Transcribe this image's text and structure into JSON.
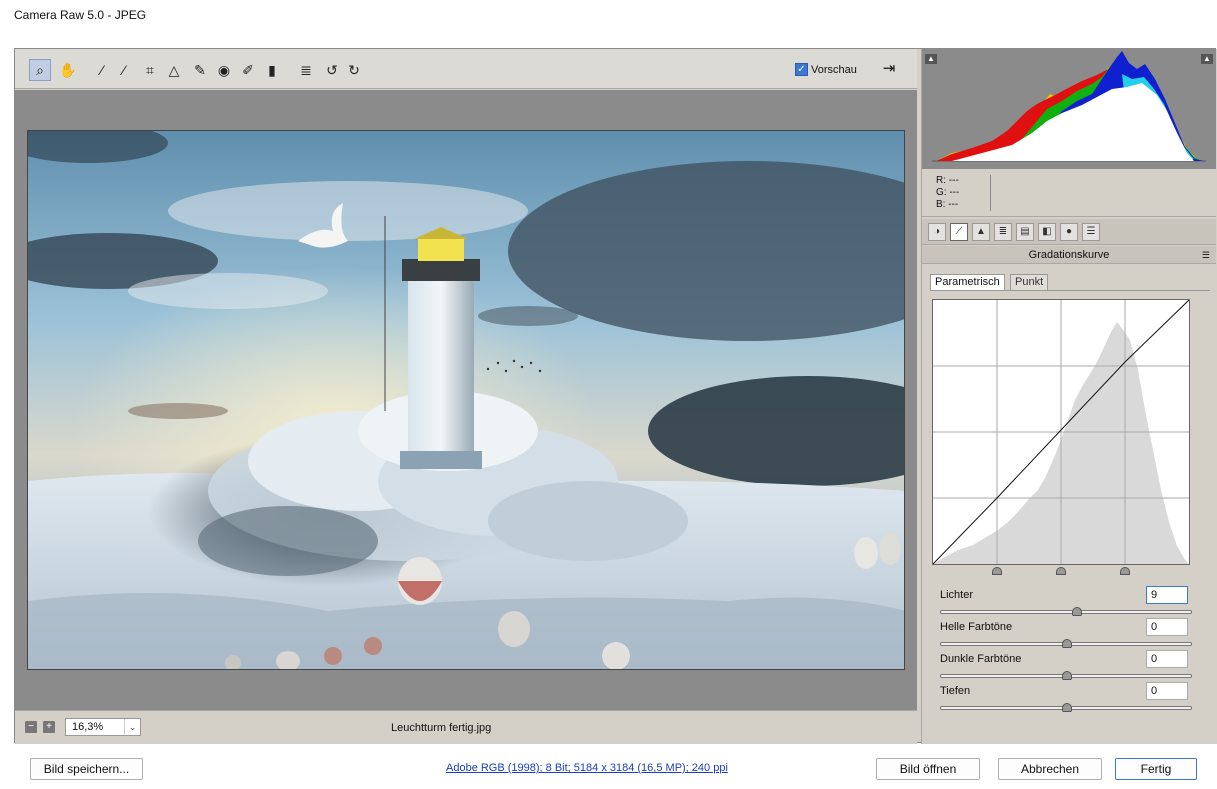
{
  "window": {
    "title": "Camera Raw 5.0 - JPEG"
  },
  "toolbar": {
    "tools": [
      {
        "icon": "zoom-tool-icon",
        "glyph": "⌕",
        "active": true
      },
      {
        "icon": "hand-tool-icon",
        "glyph": "✋"
      },
      {
        "icon": "white-balance-tool-icon",
        "glyph": "⁄"
      },
      {
        "icon": "color-sampler-tool-icon",
        "glyph": "⁄"
      },
      {
        "icon": "crop-tool-icon",
        "glyph": "⌗"
      },
      {
        "icon": "straighten-tool-icon",
        "glyph": "△"
      },
      {
        "icon": "retouch-tool-icon",
        "glyph": "✎"
      },
      {
        "icon": "red-eye-tool-icon",
        "glyph": "◉"
      },
      {
        "icon": "adjustment-brush-icon",
        "glyph": "✐"
      },
      {
        "icon": "graduated-filter-icon",
        "glyph": "▮"
      },
      {
        "icon": "preferences-icon",
        "glyph": "≣"
      },
      {
        "icon": "rotate-left-icon",
        "glyph": "↺"
      },
      {
        "icon": "rotate-right-icon",
        "glyph": "↻"
      }
    ],
    "preview_label": "Vorschau",
    "preview_checked": true
  },
  "preview": {
    "zoom_value": "16,3%",
    "filename": "Leuchtturm fertig.jpg"
  },
  "readout": {
    "r": "R:  ---",
    "g": "G:  ---",
    "b": "B:  ---"
  },
  "panel": {
    "title": "Gradationskurve",
    "tab_parametric": "Parametrisch",
    "tab_point": "Punkt",
    "sliders": [
      {
        "label": "Lichter",
        "value": "9",
        "level": 0.54
      },
      {
        "label": "Helle Farbtöne",
        "value": "0",
        "level": 0.5
      },
      {
        "label": "Dunkle Farbtöne",
        "value": "0",
        "level": 0.5
      },
      {
        "label": "Tiefen",
        "value": "0",
        "level": 0.5
      }
    ]
  },
  "footer": {
    "save_label": "Bild speichern...",
    "info": "Adobe RGB (1998); 8 Bit; 5184 x 3184 (16,5 MP); 240 ppi",
    "open_label": "Bild öffnen",
    "cancel_label": "Abbrechen",
    "done_label": "Fertig"
  }
}
